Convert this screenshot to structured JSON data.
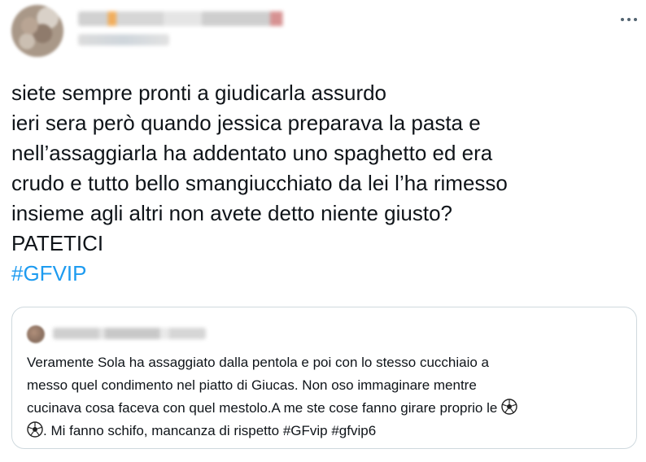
{
  "tweet": {
    "lines": [
      "siete sempre pronti a giudicarla assurdo",
      "ieri sera però quando jessica preparava  la pasta e",
      "nell’assaggiarla ha addentato uno spaghetto ed era",
      "crudo e tutto bello smangiucchiato da lei l’ha rimesso",
      "insieme agli altri non avete detto niente giusto?",
      "PATETICI"
    ],
    "hashtag": "#GFVIP",
    "hashtag_color": "#1d9bf0",
    "more_icon": "more-horizontal-icon"
  },
  "quote": {
    "line1": "Veramente Sola ha assaggiato dalla pentola e poi con lo stesso cucchiaio a",
    "line2": "messo quel condimento nel piatto di Giucas. Non oso immaginare mentre",
    "line3": "cucinava cosa faceva con quel mestolo.A me ste cose fanno girare proprio le",
    "line4_after_emoji": ". Mi fanno schifo, mancanza di rispetto ",
    "hashtag1": "#GFvip",
    "hashtag2": "#gfvip6",
    "emoji_icon": "soccer-ball-icon"
  }
}
